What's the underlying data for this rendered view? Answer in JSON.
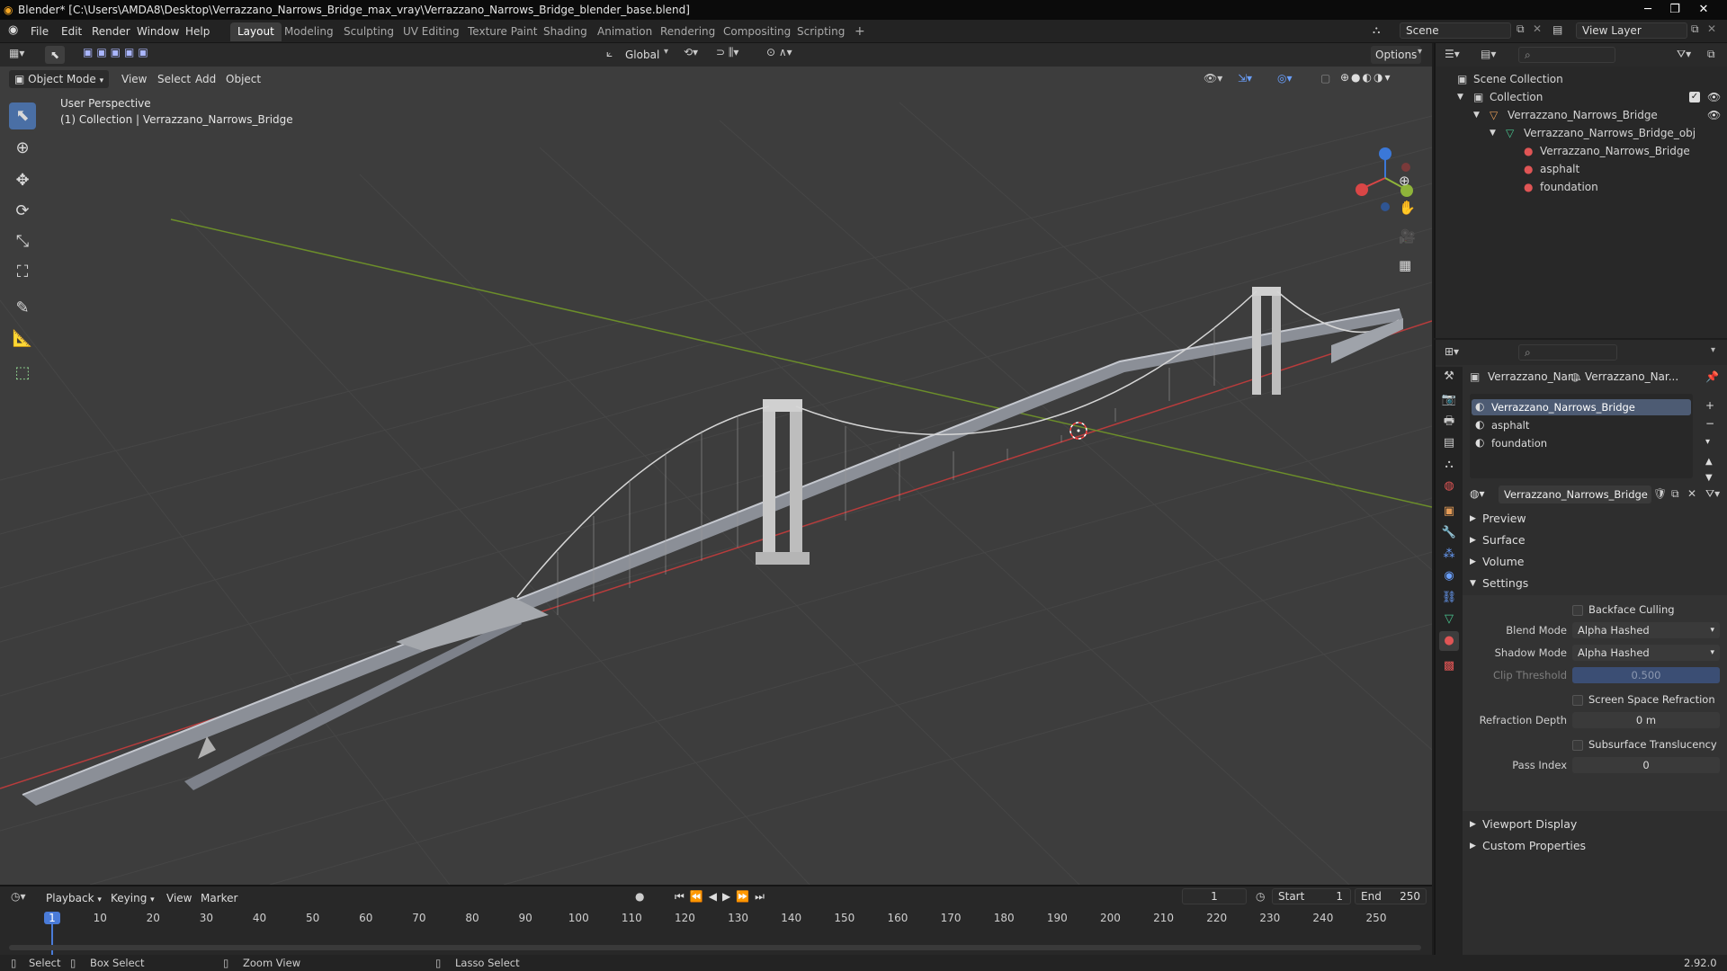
{
  "title": "Blender* [C:\\Users\\AMDA8\\Desktop\\Verrazzano_Narrows_Bridge_max_vray\\Verrazzano_Narrows_Bridge_blender_base.blend]",
  "menu": [
    "File",
    "Edit",
    "Render",
    "Window",
    "Help"
  ],
  "workspaces": [
    "Layout",
    "Modeling",
    "Sculpting",
    "UV Editing",
    "Texture Paint",
    "Shading",
    "Animation",
    "Rendering",
    "Compositing",
    "Scripting"
  ],
  "scene": "Scene",
  "view_layer": "View Layer",
  "toolbar": {
    "transform": "Global",
    "options": "Options"
  },
  "viewport": {
    "mode": "Object Mode",
    "menus": [
      "View",
      "Select",
      "Add",
      "Object"
    ],
    "perspective": "User Perspective",
    "collection_info": "(1) Collection | Verrazzano_Narrows_Bridge"
  },
  "outliner": {
    "rows": [
      "Scene Collection",
      "Collection",
      "Verrazzano_Narrows_Bridge",
      "Verrazzano_Narrows_Bridge_obj",
      "Verrazzano_Narrows_Bridge",
      "asphalt",
      "foundation"
    ]
  },
  "properties": {
    "object_name": "Verrazzano_Nar...",
    "material_name_short": "Verrazzano_Nar...",
    "slots": [
      "Verrazzano_Narrows_Bridge",
      "asphalt",
      "foundation"
    ],
    "material": "Verrazzano_Narrows_Bridge",
    "panels": {
      "preview": "Preview",
      "surface": "Surface",
      "volume": "Volume",
      "settings": "Settings",
      "viewport_display": "Viewport Display",
      "custom_properties": "Custom Properties"
    },
    "settings": {
      "backface_culling": "Backface Culling",
      "blend_mode_label": "Blend Mode",
      "blend_mode": "Alpha Hashed",
      "shadow_mode_label": "Shadow Mode",
      "shadow_mode": "Alpha Hashed",
      "clip_threshold_label": "Clip Threshold",
      "clip_threshold": "0.500",
      "screen_space_refraction": "Screen Space Refraction",
      "refraction_depth_label": "Refraction Depth",
      "refraction_depth": "0 m",
      "subsurface_translucency": "Subsurface Translucency",
      "pass_index_label": "Pass Index",
      "pass_index": "0"
    }
  },
  "timeline": {
    "menus": [
      "Playback",
      "Keying",
      "View",
      "Marker"
    ],
    "current_frame": "1",
    "start_label": "Start",
    "start": "1",
    "end_label": "End",
    "end": "250",
    "ticks": [
      "1",
      "10",
      "20",
      "30",
      "40",
      "50",
      "60",
      "70",
      "80",
      "90",
      "100",
      "110",
      "120",
      "130",
      "140",
      "150",
      "160",
      "170",
      "180",
      "190",
      "200",
      "210",
      "220",
      "230",
      "240",
      "250"
    ]
  },
  "status": {
    "select": "Select",
    "box_select": "Box Select",
    "zoom_view": "Zoom View",
    "lasso_select": "Lasso Select",
    "version": "2.92.0"
  }
}
